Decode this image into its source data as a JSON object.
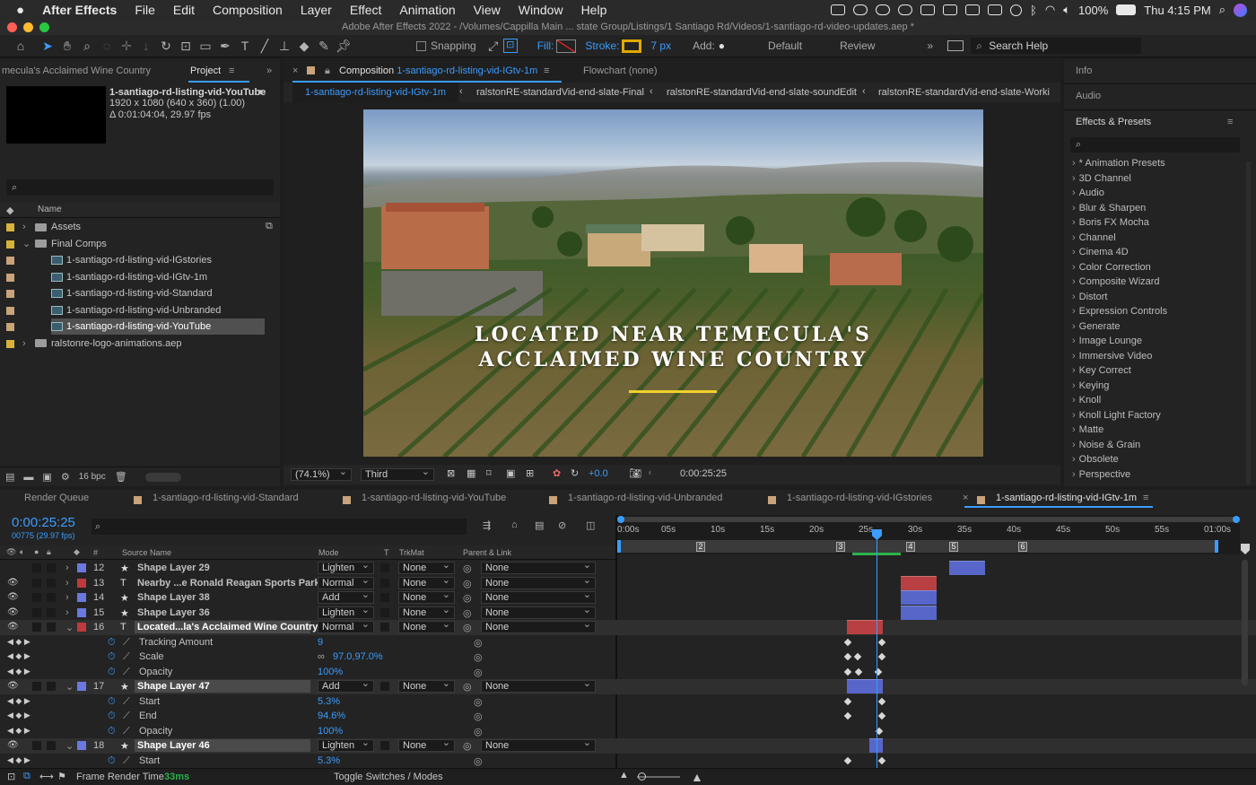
{
  "menubar": {
    "app": "After Effects",
    "items": [
      "File",
      "Edit",
      "Composition",
      "Layer",
      "Effect",
      "Animation",
      "View",
      "Window",
      "Help"
    ],
    "battery": "100%",
    "clock": "Thu 4:15 PM"
  },
  "window": {
    "title": "Adobe After Effects 2022 - /Volumes/Cappilla Main ... state Group/Listings/1 Santiago Rd/Videos/1-santiago-rd-video-updates.aep *"
  },
  "toolbar": {
    "snapping": "Snapping",
    "fill": "Fill:",
    "stroke": "Stroke:",
    "stroke_width": "7 px",
    "add": "Add:",
    "workspace_default": "Default",
    "workspace_review": "Review",
    "search": "Search Help"
  },
  "project": {
    "header_left": "mecula's Acclaimed Wine Country",
    "tab": "Project",
    "selected_name": "1-santiago-rd-listing-vid-YouTube",
    "selected_res": "1920 x 1080  (640 x 360) (1.00)",
    "selected_dur": "Δ 0:01:04:04, 29.97 fps",
    "column_name": "Name",
    "bpc": "16 bpc",
    "items": [
      {
        "label": "Assets",
        "kind": "folder",
        "indent": 0
      },
      {
        "label": "Final Comps",
        "kind": "folder",
        "indent": 0
      },
      {
        "label": "1-santiago-rd-listing-vid-IGstories",
        "kind": "comp",
        "indent": 1
      },
      {
        "label": "1-santiago-rd-listing-vid-IGtv-1m",
        "kind": "comp",
        "indent": 1
      },
      {
        "label": "1-santiago-rd-listing-vid-Standard",
        "kind": "comp",
        "indent": 1
      },
      {
        "label": "1-santiago-rd-listing-vid-Unbranded",
        "kind": "comp",
        "indent": 1
      },
      {
        "label": "1-santiago-rd-listing-vid-YouTube",
        "kind": "comp",
        "indent": 1
      },
      {
        "label": "ralstonre-logo-animations.aep",
        "kind": "folder",
        "indent": 0
      }
    ]
  },
  "composition": {
    "tab_prefix": "Composition",
    "tab_name": "1-santiago-rd-listing-vid-IGtv-1m",
    "flowchart": "Flowchart (none)",
    "breadcrumbs": [
      "1-santiago-rd-listing-vid-IGtv-1m",
      "ralstonRE-standardVid-end-slate-Final",
      "ralstonRE-standardVid-end-slate-soundEdit",
      "ralstonRE-standardVid-end-slate-Worki"
    ],
    "caption_line1": "LOCATED NEAR TEMECULA'S",
    "caption_line2": "ACCLAIMED WINE COUNTRY",
    "zoom": "(74.1%)",
    "resolution": "Third",
    "exposure": "+0.0",
    "timecode": "0:00:25:25"
  },
  "right_panel": {
    "info": "Info",
    "audio": "Audio",
    "effects_title": "Effects & Presets",
    "effects": [
      "* Animation Presets",
      "3D Channel",
      "Audio",
      "Blur & Sharpen",
      "Boris FX Mocha",
      "Channel",
      "Cinema 4D",
      "Color Correction",
      "Composite Wizard",
      "Distort",
      "Expression Controls",
      "Generate",
      "Image Lounge",
      "Immersive Video",
      "Key Correct",
      "Keying",
      "Knoll",
      "Knoll Light Factory",
      "Matte",
      "Noise & Grain",
      "Obsolete",
      "Perspective"
    ]
  },
  "timeline": {
    "tabs": [
      "Render Queue",
      "1-santiago-rd-listing-vid-Standard",
      "1-santiago-rd-listing-vid-YouTube",
      "1-santiago-rd-listing-vid-Unbranded",
      "1-santiago-rd-listing-vid-IGstories",
      "1-santiago-rd-listing-vid-IGtv-1m"
    ],
    "timecode": "0:00:25:25",
    "frames": "00775 (29.97 fps)",
    "columns": {
      "num": "#",
      "source": "Source Name",
      "mode": "Mode",
      "t": "T",
      "trkmat": "TrkMat",
      "parent": "Parent & Link"
    },
    "ruler": [
      "0:00s",
      "05s",
      "10s",
      "15s",
      "20s",
      "25s",
      "30s",
      "35s",
      "40s",
      "45s",
      "50s",
      "55s",
      "01:00s"
    ],
    "markers": [
      "2",
      "3",
      "4",
      "5",
      "6"
    ],
    "footer_render": "Frame Render Time",
    "footer_ms": "33ms",
    "footer_toggle": "Toggle Switches / Modes",
    "rows": [
      {
        "kind": "layer",
        "num": "12",
        "type": "★",
        "name": "Shape Layer 29",
        "mode": "Lighten",
        "trk": "None",
        "parent": "None",
        "color": "#6b78e0"
      },
      {
        "kind": "layer",
        "num": "13",
        "type": "T",
        "name": "Nearby ...e Ronald Reagan Sports Park",
        "mode": "Normal",
        "trk": "None",
        "parent": "None",
        "color": "#c0393b"
      },
      {
        "kind": "layer",
        "num": "14",
        "type": "★",
        "name": "Shape Layer 38",
        "mode": "Add",
        "trk": "None",
        "parent": "None",
        "color": "#6b78e0"
      },
      {
        "kind": "layer",
        "num": "15",
        "type": "★",
        "name": "Shape Layer 36",
        "mode": "Lighten",
        "trk": "None",
        "parent": "None",
        "color": "#6b78e0"
      },
      {
        "kind": "layer",
        "num": "16",
        "type": "T",
        "name": "Located...la's Acclaimed Wine Country",
        "mode": "Normal",
        "trk": "None",
        "parent": "None",
        "color": "#c0393b",
        "selected": true
      },
      {
        "kind": "prop",
        "name": "Tracking Amount",
        "value": "9"
      },
      {
        "kind": "prop",
        "name": "Scale",
        "value": "97.0,97.0%"
      },
      {
        "kind": "prop",
        "name": "Opacity",
        "value": "100%"
      },
      {
        "kind": "layer",
        "num": "17",
        "type": "★",
        "name": "Shape Layer 47",
        "mode": "Add",
        "trk": "None",
        "parent": "None",
        "color": "#6b78e0",
        "selected": true
      },
      {
        "kind": "prop",
        "name": "Start",
        "value": "5.3%"
      },
      {
        "kind": "prop",
        "name": "End",
        "value": "94.6%"
      },
      {
        "kind": "prop",
        "name": "Opacity",
        "value": "100%"
      },
      {
        "kind": "layer",
        "num": "18",
        "type": "★",
        "name": "Shape Layer 46",
        "mode": "Lighten",
        "trk": "None",
        "parent": "None",
        "color": "#6b78e0",
        "selected": true
      },
      {
        "kind": "prop",
        "name": "Start",
        "value": "5.3%"
      }
    ]
  }
}
